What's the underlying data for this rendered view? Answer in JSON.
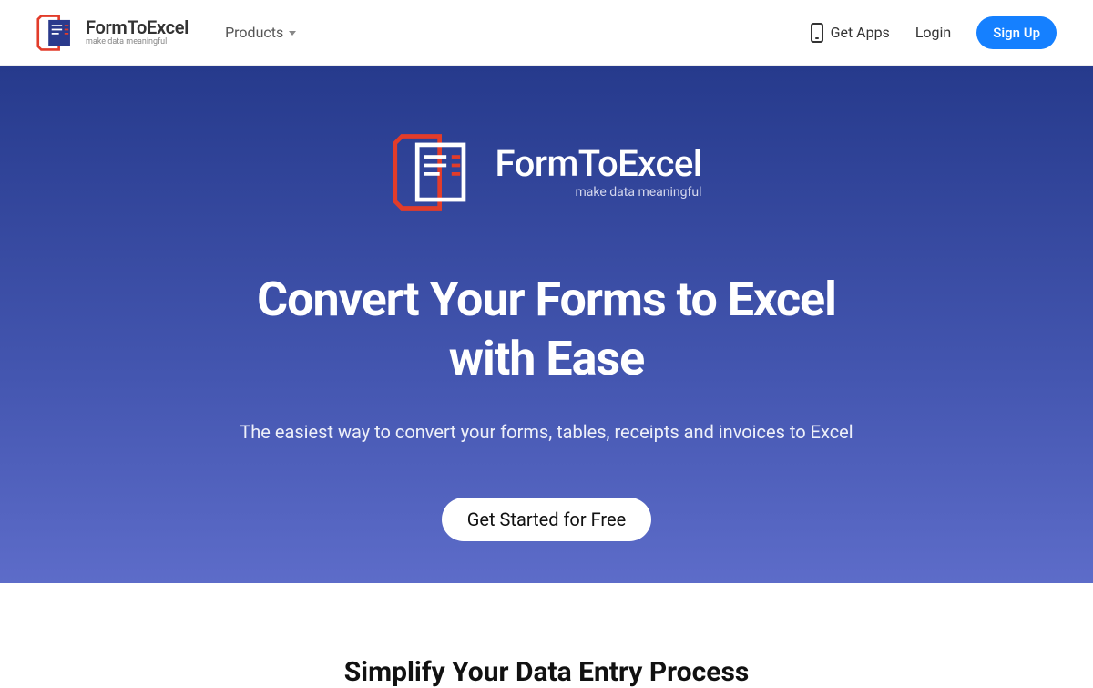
{
  "brand": {
    "name": "FormToExcel",
    "tagline": "make data meaningful"
  },
  "nav": {
    "products_label": "Products",
    "get_apps_label": "Get Apps",
    "login_label": "Login",
    "signup_label": "Sign Up"
  },
  "hero": {
    "brand_name": "FormToExcel",
    "brand_tagline": "make data meaningful",
    "title_line1": "Convert Your Forms to Excel",
    "title_line2": "with Ease",
    "subtitle": "The easiest way to convert your forms, tables, receipts and invoices to Excel",
    "cta_label": "Get Started for Free"
  },
  "section2": {
    "title": "Simplify Your Data Entry Process"
  },
  "colors": {
    "primary_button": "#1580ff",
    "hero_gradient_top": "#263a8c",
    "hero_gradient_bottom": "#5d6cc9",
    "logo_red": "#e23c2a",
    "logo_blue": "#2a3a8c"
  }
}
